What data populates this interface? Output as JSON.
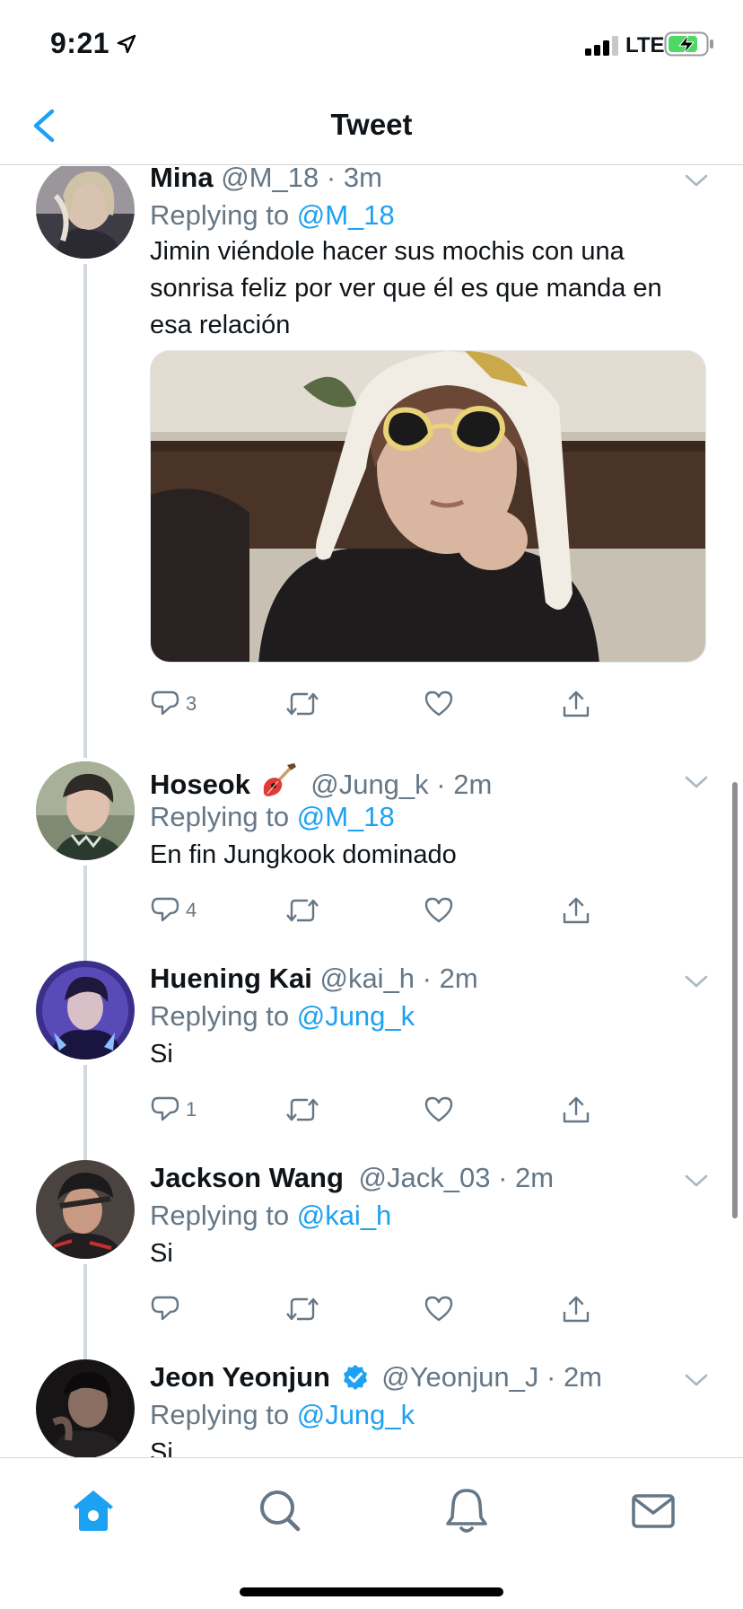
{
  "status_bar": {
    "time": "9:21",
    "network": "LTE"
  },
  "header": {
    "title": "Tweet"
  },
  "reply_prefix": "Replying to",
  "tweets": [
    {
      "name": "Mina",
      "handle": "@M_18",
      "time": "3m",
      "replying_to": "@M_18",
      "text": "Jimin viéndole hacer sus mochis con una sonrisa feliz por ver que él es que manda en esa relación",
      "has_media": true,
      "reply_count": "3"
    },
    {
      "name": "Hoseok",
      "name_emoji": "guitar",
      "handle": "@Jung_k",
      "time": "2m",
      "replying_to": "@M_18",
      "text": "En fin Jungkook dominado",
      "reply_count": "4"
    },
    {
      "name": "Huening Kai",
      "handle": "@kai_h",
      "time": "2m",
      "replying_to": "@Jung_k",
      "text": "Si",
      "reply_count": "1"
    },
    {
      "name": "Jackson Wang",
      "handle": "@Jack_03",
      "time": "2m",
      "replying_to": "@kai_h",
      "text": "Si",
      "reply_count": ""
    },
    {
      "name": "Jeon Yeonjun",
      "verified": true,
      "handle": "@Yeonjun_J",
      "time": "2m",
      "replying_to": "@Jung_k",
      "text": "Si"
    }
  ],
  "icons": {
    "back": "chevron-left-icon",
    "reply": "comment-icon",
    "retweet": "retweet-icon",
    "like": "heart-icon",
    "share": "share-icon",
    "tab_home": "home-icon",
    "tab_search": "search-icon",
    "tab_notifications": "bell-icon",
    "tab_messages": "mail-icon"
  },
  "colors": {
    "accent": "#1da1f2",
    "muted": "#657786",
    "thread_line": "#cfd9de"
  }
}
